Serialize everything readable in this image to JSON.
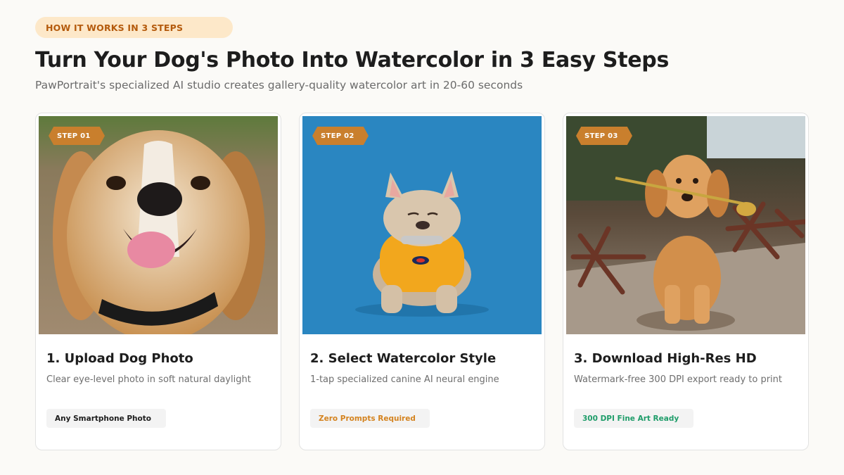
{
  "header": {
    "pill_label": "HOW IT WORKS IN 3 STEPS",
    "title": "Turn Your Dog's Photo Into Watercolor in 3 Easy Steps",
    "subtitle": "PawPortrait's specialized AI studio creates gallery-quality watercolor art in 20-60 seconds"
  },
  "colors": {
    "background": "#fbfaf7",
    "pill_bg": "#fde8c9",
    "pill_text": "#b45a0c",
    "badge_bg": "#c97f2d",
    "tag_dark": "#1d1d1d",
    "tag_orange": "#d4831f",
    "tag_green": "#1f9d6a"
  },
  "steps": [
    {
      "badge": "STEP 01",
      "title": "1. Upload Dog Photo",
      "description": "Clear eye-level photo in soft natural daylight",
      "tag": "Any Smartphone Photo",
      "tag_color": "#1d1d1d",
      "image": "smiling-beagle-photo"
    },
    {
      "badge": "STEP 02",
      "title": "2. Select Watercolor Style",
      "description": "1-tap specialized canine AI neural engine",
      "tag": "Zero Prompts Required",
      "tag_color": "#d4831f",
      "image": "french-bulldog-yellow-shirt-photo"
    },
    {
      "badge": "STEP 03",
      "title": "3. Download High-Res HD",
      "description": "Watermark-free 300 DPI export ready to print",
      "tag": "300 DPI Fine Art Ready",
      "tag_color": "#1f9d6a",
      "image": "golden-retriever-rose-photo"
    }
  ]
}
